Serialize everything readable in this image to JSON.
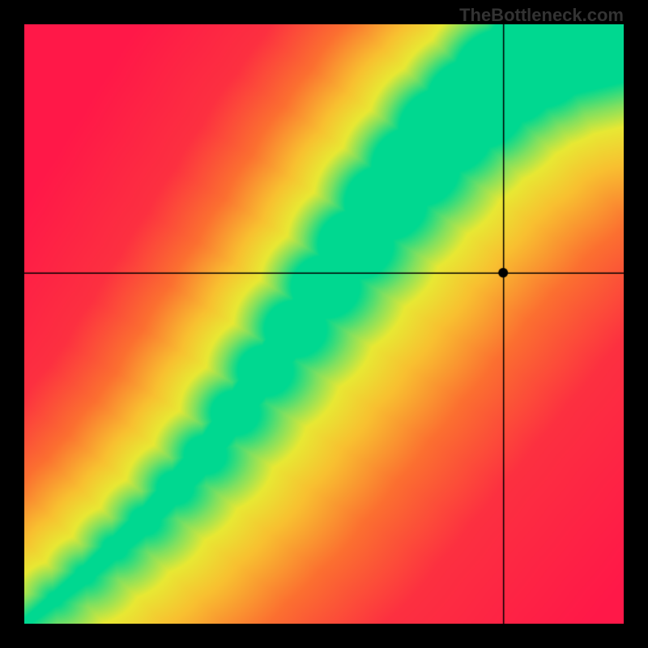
{
  "watermark": "TheBottleneck.com",
  "chart_data": {
    "type": "heatmap",
    "title": "",
    "xlabel": "",
    "ylabel": "",
    "xlim": [
      0,
      1
    ],
    "ylim": [
      0,
      1
    ],
    "marker": {
      "x": 0.8,
      "y": 0.585
    },
    "crosshair": {
      "vertical_x": 0.8,
      "horizontal_y": 0.585
    },
    "optimal_ridge": {
      "description": "green ridge indicating balanced CPU/GPU pairing; moves from bottom-left corner upward with slight S-curve, widening toward top-right",
      "points": [
        {
          "x": 0.0,
          "y": 0.0
        },
        {
          "x": 0.1,
          "y": 0.08
        },
        {
          "x": 0.2,
          "y": 0.17
        },
        {
          "x": 0.3,
          "y": 0.28
        },
        {
          "x": 0.4,
          "y": 0.42
        },
        {
          "x": 0.5,
          "y": 0.56
        },
        {
          "x": 0.6,
          "y": 0.7
        },
        {
          "x": 0.7,
          "y": 0.82
        },
        {
          "x": 0.8,
          "y": 0.91
        },
        {
          "x": 0.9,
          "y": 0.97
        },
        {
          "x": 1.0,
          "y": 1.0
        }
      ],
      "width_start": 0.008,
      "width_end": 0.1
    },
    "color_scale": {
      "description": "distance from ridge center: 0 = green, mid = yellow/orange, far = red",
      "stops": [
        {
          "d": 0.0,
          "color": "#00D890"
        },
        {
          "d": 0.06,
          "color": "#7FE060"
        },
        {
          "d": 0.12,
          "color": "#E8E833"
        },
        {
          "d": 0.22,
          "color": "#F8C030"
        },
        {
          "d": 0.38,
          "color": "#FB7030"
        },
        {
          "d": 0.6,
          "color": "#FC3040"
        },
        {
          "d": 1.0,
          "color": "#FF1848"
        }
      ]
    }
  }
}
